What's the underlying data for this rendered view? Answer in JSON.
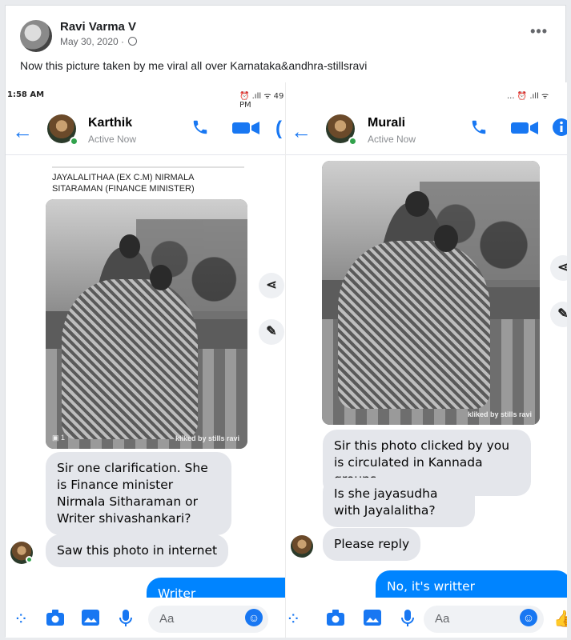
{
  "post": {
    "author": "Ravi Varma V",
    "date": "May 30, 2020 ·",
    "caption": "Now this picture  taken by me viral all over Karnataka&andhra-stillsravi",
    "more": "•••"
  },
  "left_phone": {
    "time": "1:58 AM",
    "status_icons": "⏰ .ıll ᯤ 49 PM",
    "contact_name": "Karthik",
    "contact_status": "Active Now",
    "photo_caption_line1": "JAYALALITHAA (EX C.M) NIRMALA",
    "photo_caption_line2": "SITARAMAN (FINANCE MINISTER)",
    "photo_watermark": "kliked by stills ravi",
    "photo_count": "1",
    "messages": [
      {
        "text": "Sir one clarification. She is Finance minister Nirmala Sitharaman or Writer shivashankari?"
      },
      {
        "text": "Saw this photo in internet"
      },
      {
        "text": "Writer shivashankari"
      }
    ],
    "input_placeholder": "Aa"
  },
  "right_phone": {
    "status_icons": "... ⏰ .ıll ᯤ",
    "contact_name": "Murali",
    "contact_status": "Active Now",
    "photo_watermark": "kliked by stills ravi",
    "messages": [
      {
        "text": "Sir this photo clicked by you is circulated in Kannada groups"
      },
      {
        "text": "Is she jayasudha with Jayalalitha?"
      },
      {
        "text": "Please reply"
      },
      {
        "text": "No, it's writter shivashankari"
      }
    ],
    "input_placeholder": "Aa"
  },
  "colors": {
    "messenger_blue": "#1877f2",
    "outgoing_bubble": "#0084ff",
    "incoming_bubble": "#e4e6eb",
    "online_green": "#31a24c"
  }
}
